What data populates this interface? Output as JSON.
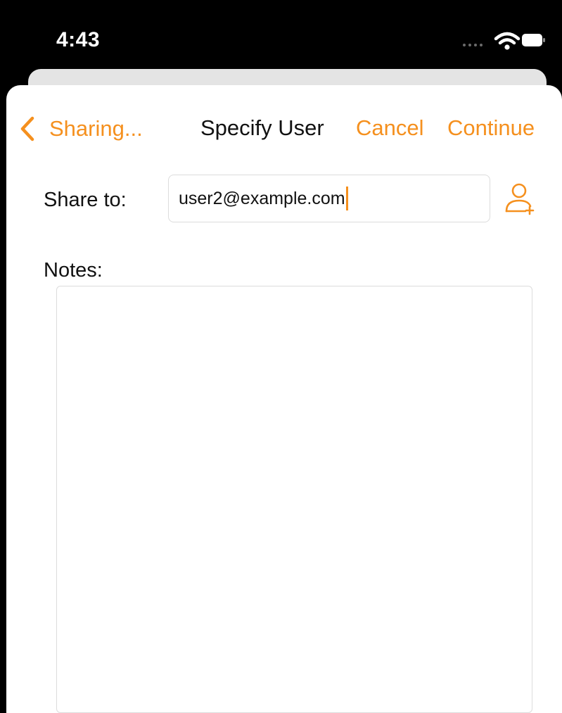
{
  "status_bar": {
    "time": "4:43",
    "icons": [
      "cellular-dots-icon",
      "wifi-icon",
      "battery-icon"
    ]
  },
  "nav": {
    "back_label": "Sharing...",
    "title": "Specify User",
    "cancel_label": "Cancel",
    "continue_label": "Continue"
  },
  "form": {
    "share_label": "Share to:",
    "share_value": "user2@example.com",
    "add_contact_icon": "add-person-icon",
    "notes_label": "Notes:",
    "notes_value": ""
  },
  "colors": {
    "accent": "#f5901e",
    "status_background": "#000000",
    "sheet_background": "#ffffff",
    "field_border": "#dcdcdc"
  }
}
